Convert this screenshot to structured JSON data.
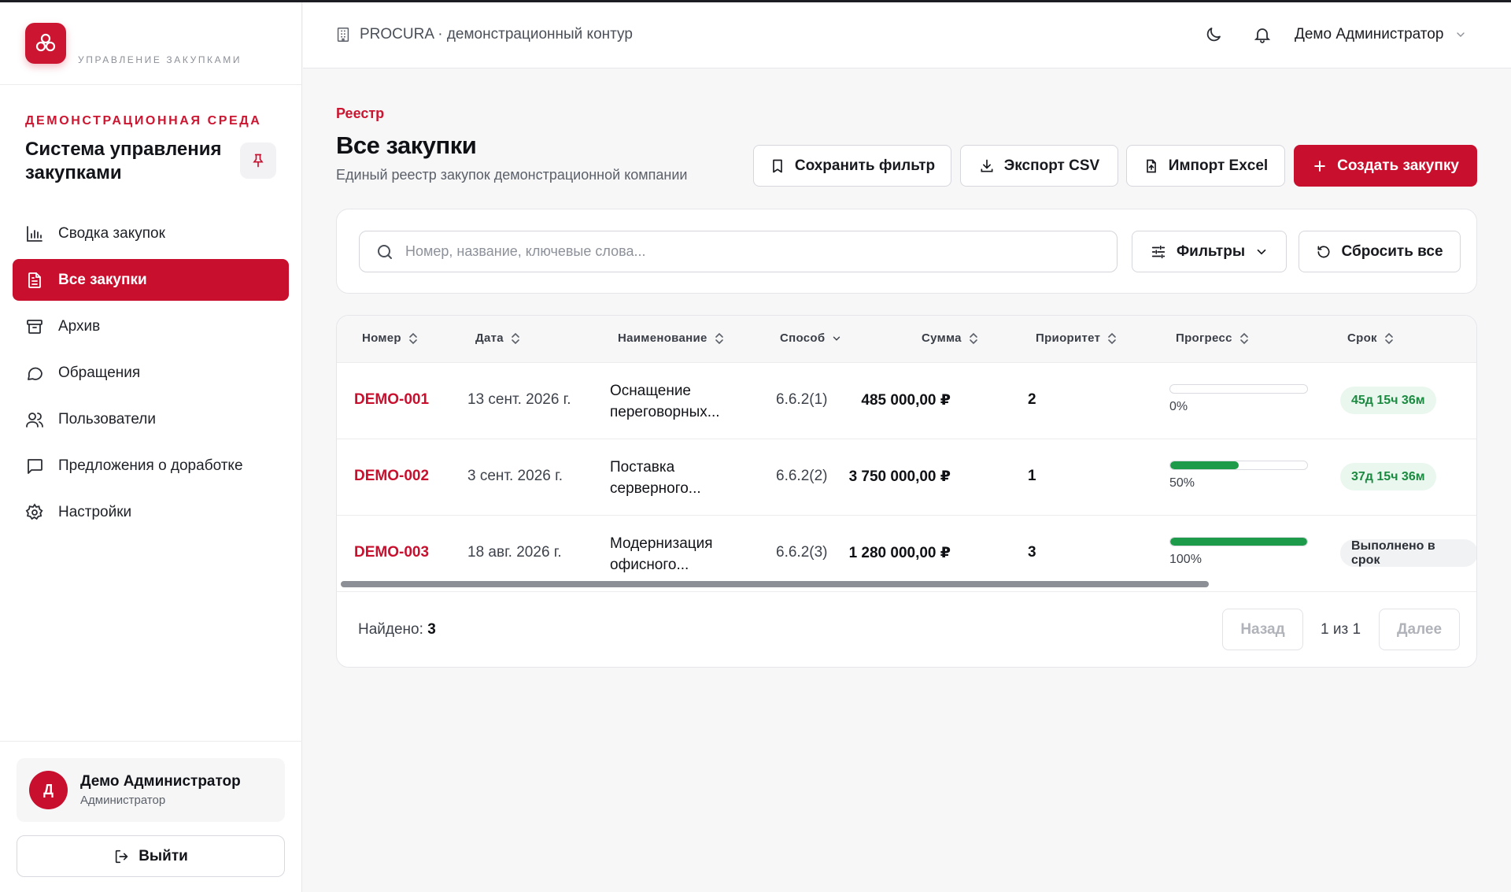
{
  "sidebar": {
    "brand_tag": "УПРАВЛЕНИЕ ЗАКУПКАМИ",
    "env_label": "ДЕМОНСТРАЦИОННАЯ СРЕДА",
    "system_title": "Система управления закупками",
    "nav": [
      {
        "label": "Сводка закупок",
        "icon": "bar-chart-icon",
        "active": false
      },
      {
        "label": "Все закупки",
        "icon": "document-list-icon",
        "active": true
      },
      {
        "label": "Архив",
        "icon": "archive-icon",
        "active": false
      },
      {
        "label": "Обращения",
        "icon": "chat-bubble-icon",
        "active": false
      },
      {
        "label": "Пользователи",
        "icon": "users-icon",
        "active": false
      },
      {
        "label": "Предложения о доработке",
        "icon": "message-square-icon",
        "active": false
      },
      {
        "label": "Настройки",
        "icon": "gear-icon",
        "active": false
      }
    ],
    "user": {
      "initial": "Д",
      "name": "Демо Администратор",
      "role": "Администратор"
    },
    "logout_label": "Выйти"
  },
  "header": {
    "breadcrumb": "PROCURA · демонстрационный контур",
    "user_name": "Демо Администратор"
  },
  "page": {
    "eyebrow": "Реестр",
    "title": "Все закупки",
    "subtitle": "Единый реестр закупок демонстрационной компании",
    "actions": {
      "save_filter": "Сохранить фильтр",
      "export_csv": "Экспорт CSV",
      "import_excel": "Импорт Excel",
      "create": "Создать закупку"
    }
  },
  "search": {
    "placeholder": "Номер, название, ключевые слова...",
    "value": "",
    "filters_label": "Фильтры",
    "reset_label": "Сбросить все"
  },
  "table": {
    "columns": [
      "Номер",
      "Дата",
      "Наименование",
      "Способ",
      "Сумма",
      "Приоритет",
      "Прогресс",
      "Срок"
    ],
    "rows": [
      {
        "number": "DEMO-001",
        "date": "13 сент. 2026 г.",
        "name": "Оснащение переговорных...",
        "method": "6.6.2(1)",
        "sum": "485 000,00 ₽",
        "priority": "2",
        "progress": 0,
        "progress_label": "0%",
        "deadline": "45д 15ч 36м",
        "deadline_style": "green"
      },
      {
        "number": "DEMO-002",
        "date": "3 сент. 2026 г.",
        "name": "Поставка серверного...",
        "method": "6.6.2(2)",
        "sum": "3 750 000,00 ₽",
        "priority": "1",
        "progress": 50,
        "progress_label": "50%",
        "deadline": "37д 15ч 36м",
        "deadline_style": "green"
      },
      {
        "number": "DEMO-003",
        "date": "18 авг. 2026 г.",
        "name": "Модернизация офисного...",
        "method": "6.6.2(3)",
        "sum": "1 280 000,00 ₽",
        "priority": "3",
        "progress": 100,
        "progress_label": "100%",
        "deadline": "Выполнено в срок",
        "deadline_style": "gray"
      }
    ]
  },
  "pagination": {
    "found_label": "Найдено:",
    "found_count": "3",
    "prev": "Назад",
    "info": "1 из 1",
    "next": "Далее"
  },
  "colors": {
    "accent": "#c8102e",
    "success": "#1d9a4a"
  }
}
